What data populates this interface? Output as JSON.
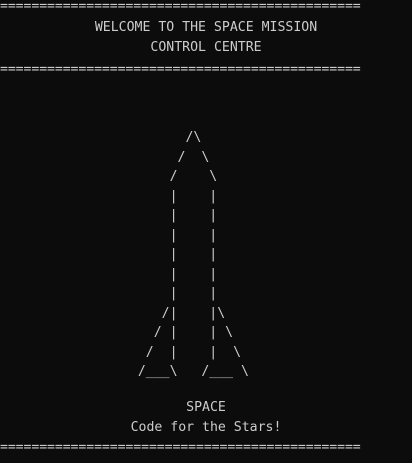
{
  "terminal": {
    "top_rule": "==============================================",
    "welcome_line_1": "WELCOME TO THE SPACE MISSION",
    "welcome_line_2": "CONTROL CENTRE",
    "middle_rule": "==============================================",
    "rocket_art": "         /\\\n        /  \\\n       /    \\\n       |    |\n       |    |\n       |    |\n       |    |\n       |    |\n       |    |\n      /|    |\\\n     / |    | \\\n    /  |    |  \\\n   /___\\   /___ \\",
    "brand": "SPACE",
    "tagline": "Code for the Stars!",
    "bottom_rule": "==============================================",
    "partial_line": "  .  .   .  .   .  .  .    .  .  .  .  .    ."
  }
}
